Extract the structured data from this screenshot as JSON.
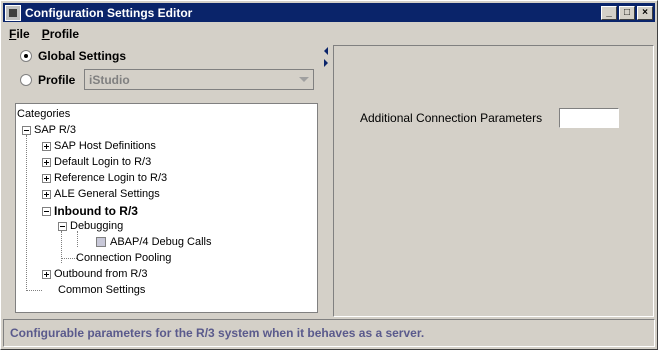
{
  "window": {
    "title": "Configuration Settings Editor"
  },
  "menu": {
    "file": "File",
    "profile": "Profile"
  },
  "left": {
    "global_label": "Global Settings",
    "profile_label": "Profile",
    "profile_value": "iStudio",
    "categories_label": "Categories"
  },
  "tree": {
    "root": "SAP R/3",
    "n1": "SAP Host Definitions",
    "n2": "Default Login to R/3",
    "n3": "Reference Login to R/3",
    "n4": "ALE General Settings",
    "n5": "Inbound to R/3",
    "n5a": "Debugging",
    "n5a1": "ABAP/4 Debug Calls",
    "n5b": "Connection Pooling",
    "n6": "Outbound from R/3",
    "n7": "Common Settings"
  },
  "right": {
    "param_label": "Additional Connection Parameters",
    "param_value": ""
  },
  "status": {
    "text": "Configurable parameters for the R/3 system when it behaves as a server."
  }
}
